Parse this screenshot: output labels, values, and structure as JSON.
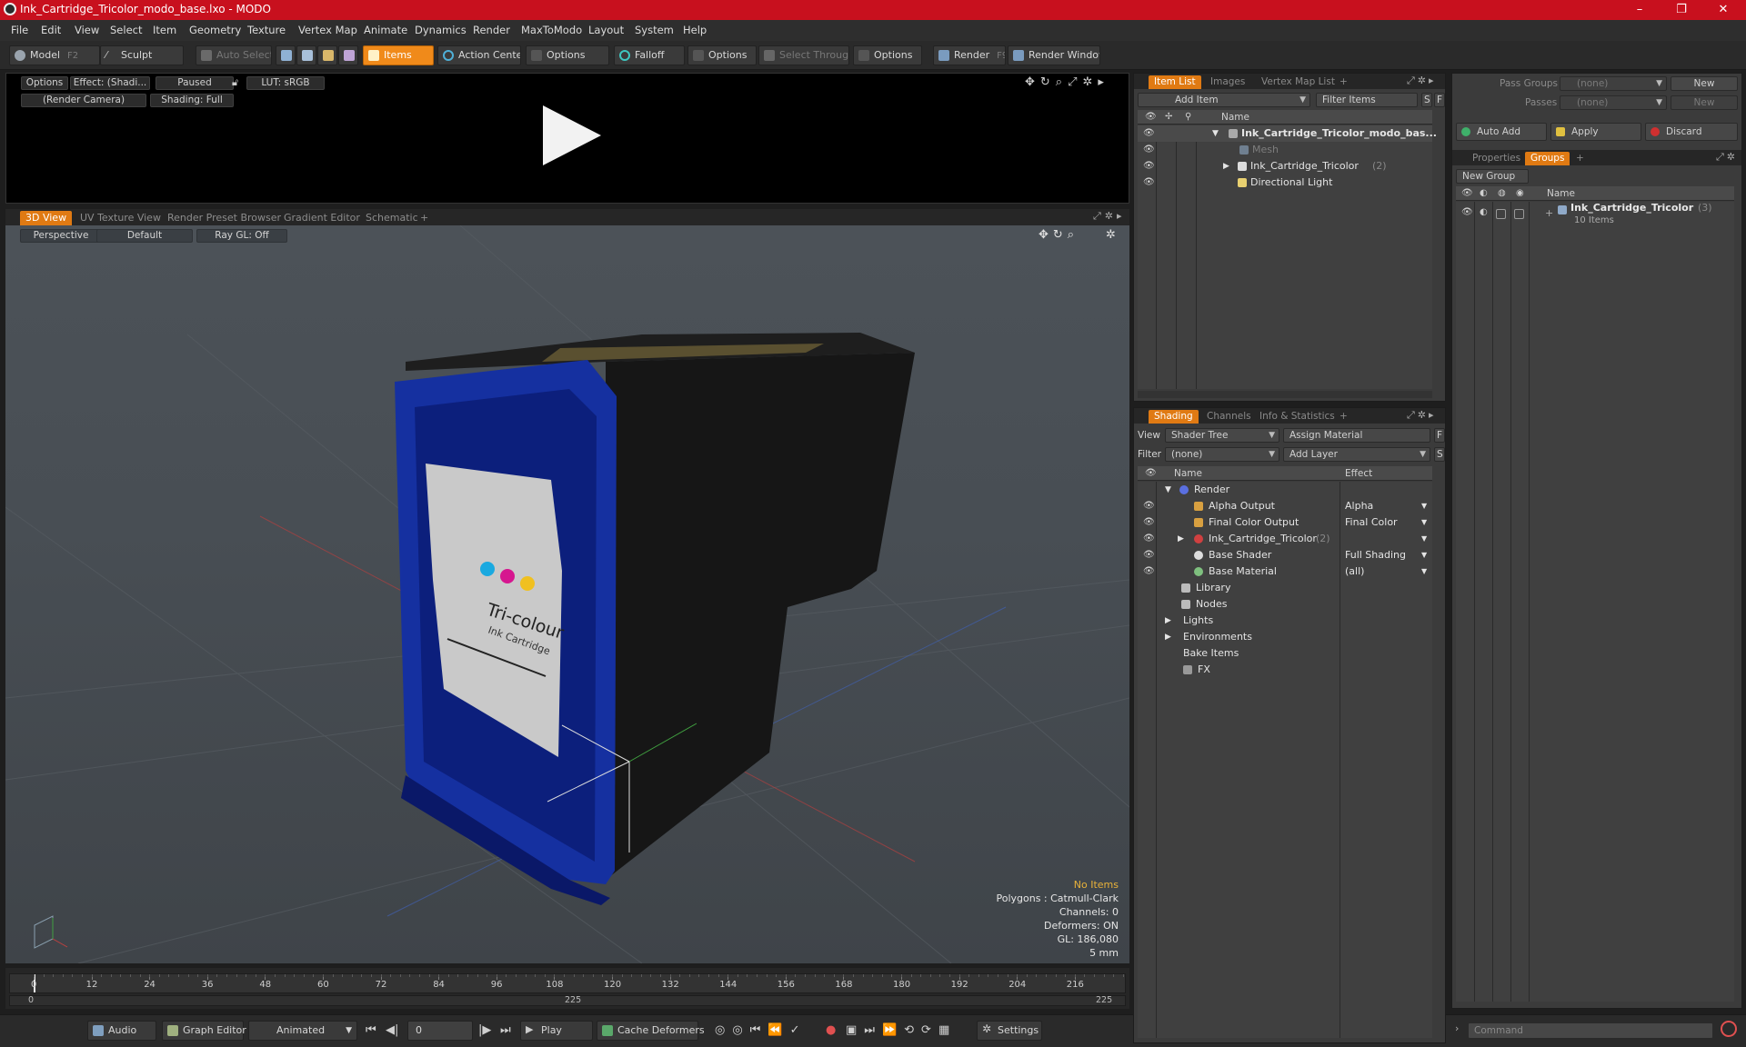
{
  "window": {
    "title": "Ink_Cartridge_Tricolor_modo_base.lxo - MODO",
    "minimize": "–",
    "maximize": "❐",
    "close": "✕"
  },
  "menu": [
    "File",
    "Edit",
    "View",
    "Select",
    "Item",
    "Geometry",
    "Texture",
    "Vertex Map",
    "Animate",
    "Dynamics",
    "Render",
    "MaxToModo",
    "Layout",
    "System",
    "Help"
  ],
  "toolbar": {
    "model": "Model",
    "model_key": "F2",
    "sculpt": "Sculpt",
    "auto_select": "Auto Select",
    "items": "Items",
    "action_center": "Action Center",
    "options1": "Options",
    "falloff": "Falloff",
    "options2": "Options",
    "select_through": "Select Through",
    "options3": "Options",
    "render": "Render",
    "render_key": "F9",
    "render_window": "Render Window"
  },
  "preview": {
    "options": "Options",
    "effect": "Effect: (Shadi...",
    "paused": "Paused",
    "lut": "LUT: sRGB",
    "camera": "(Render Camera)",
    "shading": "Shading: Full"
  },
  "viewport_tabs": [
    "3D View",
    "UV Texture View",
    "Render Preset Browser",
    "Gradient Editor",
    "Schematic",
    "+"
  ],
  "viewport": {
    "perspective": "Perspective",
    "default": "Default",
    "raygl": "Ray GL: Off",
    "label_title": "Tri-colour",
    "label_sub": "Ink Cartridge",
    "stats": {
      "no_items": "No Items",
      "polygons": "Polygons : Catmull-Clark",
      "channels": "Channels: 0",
      "deformers": "Deformers: ON",
      "gl": "GL: 186,080",
      "scale": "5 mm"
    }
  },
  "timeline": {
    "ticks": [
      "0",
      "12",
      "24",
      "36",
      "48",
      "60",
      "72",
      "84",
      "96",
      "108",
      "120",
      "132",
      "144",
      "156",
      "168",
      "180",
      "192",
      "204",
      "216"
    ],
    "start": "0",
    "mid": "225",
    "end": "225"
  },
  "transport": {
    "audio": "Audio",
    "graph_editor": "Graph Editor",
    "animated": "Animated",
    "frame": "0",
    "play": "Play",
    "cache_deformers": "Cache Deformers",
    "settings": "Settings"
  },
  "item_list": {
    "tabs": [
      "Item List",
      "Images",
      "Vertex Map List",
      "+"
    ],
    "add_item": "Add Item",
    "filter_items": "Filter Items",
    "s": "S",
    "f": "F",
    "col_name": "Name",
    "rows": [
      {
        "name": "Ink_Cartridge_Tricolor_modo_bas...",
        "bold": true
      },
      {
        "name": "Mesh",
        "dim": true
      },
      {
        "name": "Ink_Cartridge_Tricolor",
        "count": "(2)"
      },
      {
        "name": "Directional Light"
      }
    ]
  },
  "shading": {
    "tabs": [
      "Shading",
      "Channels",
      "Info & Statistics",
      "+"
    ],
    "view_label": "View",
    "view_value": "Shader Tree",
    "assign_material": "Assign Material",
    "f": "F",
    "filter_label": "Filter",
    "filter_value": "(none)",
    "add_layer": "Add Layer",
    "s": "S",
    "col_name": "Name",
    "col_effect": "Effect",
    "rows": [
      {
        "name": "Render",
        "effect": ""
      },
      {
        "name": "Alpha Output",
        "effect": "Alpha"
      },
      {
        "name": "Final Color Output",
        "effect": "Final Color"
      },
      {
        "name": "Ink_Cartridge_Tricolor",
        "count": "(2)",
        "effect": ""
      },
      {
        "name": "Base Shader",
        "effect": "Full Shading"
      },
      {
        "name": "Base Material",
        "effect": "(all)"
      },
      {
        "name": "Library",
        "effect": ""
      },
      {
        "name": "Nodes",
        "effect": ""
      },
      {
        "name": "Lights",
        "effect": ""
      },
      {
        "name": "Environments",
        "effect": ""
      },
      {
        "name": "Bake Items",
        "effect": ""
      },
      {
        "name": "FX",
        "effect": ""
      }
    ]
  },
  "groups": {
    "pass_groups_label": "Pass Groups",
    "pass_groups_value": "(none)",
    "new1": "New",
    "passes_label": "Passes",
    "passes_value": "(none)",
    "new2": "New",
    "auto_add": "Auto Add",
    "apply": "Apply",
    "discard": "Discard",
    "tabs": [
      "Properties",
      "Groups",
      "+"
    ],
    "new_group": "New Group",
    "col_name": "Name",
    "group_name": "Ink_Cartridge_Tricolor",
    "group_count": "(3)",
    "group_items": "10 Items"
  },
  "command": {
    "placeholder": "Command"
  }
}
